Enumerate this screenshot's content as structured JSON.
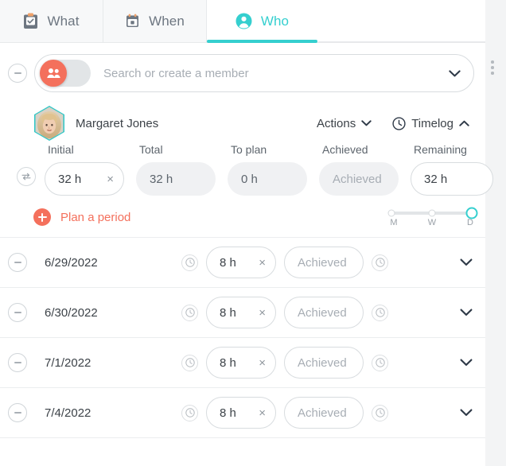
{
  "tabs": [
    {
      "label": "What",
      "icon": "clipboard-check-icon",
      "active": false
    },
    {
      "label": "When",
      "icon": "calendar-icon",
      "active": false
    },
    {
      "label": "Who",
      "icon": "person-circle-icon",
      "active": true
    }
  ],
  "search": {
    "placeholder": "Search or create a member",
    "value": "",
    "toggle_on": true,
    "toggle_icon": "people-icon",
    "dropdown_icon": "chevron-down-icon",
    "remove_icon": "minus-circle-icon"
  },
  "overflow_menu": {
    "icon": "kebab-menu-icon"
  },
  "member": {
    "name": "Margaret Jones",
    "avatar": "hexagon-avatar",
    "actions_label": "Actions",
    "timelog_label": "Timelog",
    "actions_icon": "chevron-down-icon",
    "timelog_icon": "clock-icon",
    "timelog_toggle_icon": "chevron-up-icon"
  },
  "stats": {
    "swap_icon": "swap-arrows-icon",
    "fields": [
      {
        "label": "Initial",
        "value": "32 h",
        "readonly": false,
        "muted": false,
        "clearable": true,
        "clear_glyph": "×"
      },
      {
        "label": "Total",
        "value": "32 h",
        "readonly": true,
        "muted": false,
        "clearable": false,
        "clear_glyph": ""
      },
      {
        "label": "To plan",
        "value": "0 h",
        "readonly": true,
        "muted": false,
        "clearable": false,
        "clear_glyph": ""
      },
      {
        "label": "Achieved",
        "value": "Achieved",
        "readonly": true,
        "muted": true,
        "clearable": false,
        "clear_glyph": ""
      },
      {
        "label": "Remaining",
        "value": "32 h",
        "readonly": false,
        "muted": false,
        "clearable": false,
        "clear_glyph": ""
      }
    ]
  },
  "plan": {
    "label": "Plan a period",
    "add_icon": "plus-circle-icon",
    "slider": {
      "options": [
        "M",
        "W",
        "D"
      ],
      "selected": "D"
    }
  },
  "periods": [
    {
      "date": "6/29/2022",
      "hours": "8 h",
      "achieved_placeholder": "Achieved",
      "clear_glyph": "×"
    },
    {
      "date": "6/30/2022",
      "hours": "8 h",
      "achieved_placeholder": "Achieved",
      "clear_glyph": "×"
    },
    {
      "date": "7/1/2022",
      "hours": "8 h",
      "achieved_placeholder": "Achieved",
      "clear_glyph": "×"
    },
    {
      "date": "7/4/2022",
      "hours": "8 h",
      "achieved_placeholder": "Achieved",
      "clear_glyph": "×"
    }
  ],
  "row_icons": {
    "remove_icon": "minus-circle-icon",
    "start_timer_icon": "clock-circle-icon",
    "achieved_timer_icon": "clock-circle-icon",
    "expand_icon": "chevron-down-icon"
  },
  "colors": {
    "accent_teal": "#35cfcf",
    "accent_coral": "#f4705c",
    "text_primary": "#3c4248",
    "text_muted": "#a7adb4",
    "border": "#d8dcdf"
  }
}
